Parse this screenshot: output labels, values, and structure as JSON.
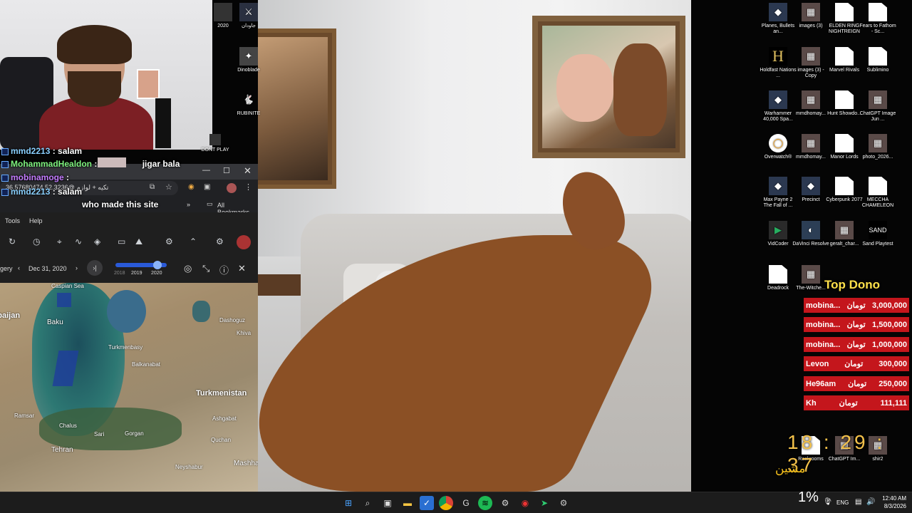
{
  "webcam_chat": [
    {
      "name": "mmd2213",
      "msg": "salam"
    },
    {
      "name": "MohammadHealdon",
      "msg": "jigar bala"
    },
    {
      "name": "mobinamoge",
      "msg": ""
    },
    {
      "name": "mmd2213",
      "msg": "salam"
    },
    {
      "name": "",
      "msg": "who made this site"
    }
  ],
  "browser": {
    "url": "تکیه + لوازم @36.57680474,52.3236",
    "bookmarks_label": "All Bookmarks"
  },
  "mapapp": {
    "menu": [
      "Tools",
      "Help"
    ],
    "date": "Dec 31, 2020",
    "timeline_years": [
      "2018",
      "2019",
      "2020"
    ],
    "left_label": "gery"
  },
  "map_labels": {
    "caspian": "Caspian Sea",
    "baijan": "rbaijan",
    "baku": "Baku",
    "turkmenbasy": "Turkmenbasy",
    "dashoguz": "Dashoguz",
    "khiva": "Khiva",
    "balkanabat": "Balkanabat",
    "turkmenistan": "Turkmenistan",
    "ramsar": "Ramsar",
    "chalus": "Chalus",
    "sari": "Sari",
    "gorgan": "Gorgan",
    "ashgabat": "Ashgabat",
    "tehran": "Tehran",
    "quchan": "Quchan",
    "mashhad": "Mashha",
    "neyshabur": "Neyshabur"
  },
  "desktop_icons_left": [
    {
      "label": "2020",
      "icon": "image"
    },
    {
      "label": "جاودان",
      "icon": "game"
    },
    {
      "label": "Dinoblade",
      "icon": "game"
    },
    {
      "label": "RUBINITE",
      "icon": "rabbit"
    },
    {
      "label": "DONT PLAY",
      "icon": "game"
    }
  ],
  "desktop_icons_right": [
    {
      "label": "Planes, Bullets an...",
      "icon": "game"
    },
    {
      "label": "images (3)",
      "icon": "image"
    },
    {
      "label": "ELDEN RING NIGHTREIGN",
      "icon": "file"
    },
    {
      "label": "Fears to Fathom - Sc...",
      "icon": "file"
    },
    {
      "label": "Holdfast Nations ...",
      "icon": "holdfast"
    },
    {
      "label": "images (3) - Copy",
      "icon": "image"
    },
    {
      "label": "Marvel Rivals",
      "icon": "file"
    },
    {
      "label": "Sublimino",
      "icon": "file"
    },
    {
      "label": "Warhammer 40,000 Spa...",
      "icon": "game"
    },
    {
      "label": "mmdhomay...",
      "icon": "image"
    },
    {
      "label": "Hunt Showdo...",
      "icon": "file"
    },
    {
      "label": "ChatGPT Image Jun ...",
      "icon": "image"
    },
    {
      "label": "Overwatch®",
      "icon": "overwatch"
    },
    {
      "label": "mmdhomay...",
      "icon": "image"
    },
    {
      "label": "Manor Lords",
      "icon": "file"
    },
    {
      "label": "photo_2026...",
      "icon": "image"
    },
    {
      "label": "Max Payne 2 The Fall of ...",
      "icon": "game"
    },
    {
      "label": "Precinct",
      "icon": "game"
    },
    {
      "label": "Cyberpunk 2077",
      "icon": "file"
    },
    {
      "label": "MECCHA CHAMELEON",
      "icon": "file"
    },
    {
      "label": "VidCoder",
      "icon": "vidcoder"
    },
    {
      "label": "DaVinci Resolve",
      "icon": "davinci"
    },
    {
      "label": "geralt_char...",
      "icon": "image"
    },
    {
      "label": "Sand Playtest",
      "icon": "sand"
    },
    {
      "label": "Deadrock",
      "icon": "file"
    },
    {
      "label": "The-Witche...",
      "icon": "image"
    },
    {
      "label": "Rackrooms",
      "icon": "file"
    },
    {
      "label": "ChatGPT Im...",
      "icon": "image"
    },
    {
      "label": "shir2",
      "icon": "image"
    }
  ],
  "donations": {
    "title": "Top Dono",
    "currency": "تومان",
    "items": [
      {
        "name": "mobina...",
        "amount": "3,000,000"
      },
      {
        "name": "mobina...",
        "amount": "1,500,000"
      },
      {
        "name": "mobina...",
        "amount": "1,000,000"
      },
      {
        "name": "Levon",
        "amount": "300,000"
      },
      {
        "name": "He96am",
        "amount": "250,000"
      },
      {
        "name": "Kh",
        "amount": "111,111"
      }
    ]
  },
  "overlay_clock": "18 : 29 : 37",
  "overlay_text": "مشین",
  "taskbar": {
    "percent": "1%",
    "lang": "ENG",
    "time": "12:40 AM",
    "date": "8/3/2026"
  },
  "colors": {
    "dono_red": "#c4161c",
    "clock_gold": "#f3c14a",
    "taskbar": "#1c1c1c"
  }
}
